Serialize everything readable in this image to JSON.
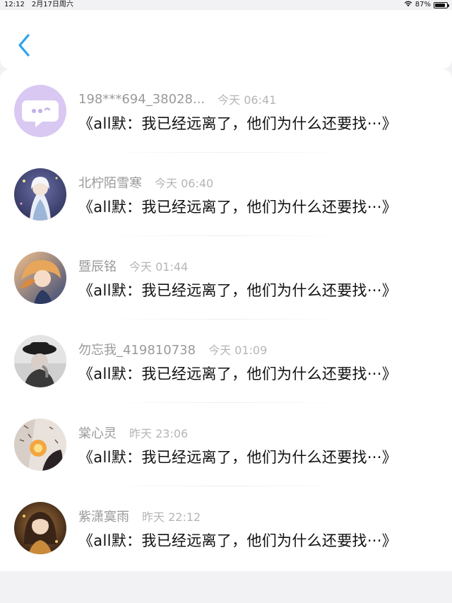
{
  "status_bar": {
    "time": "12:12",
    "date": "2月17日周六",
    "battery": "87%",
    "battery_level": 0.87
  },
  "header": {
    "back_icon": "chevron-left-icon",
    "accent_color": "#2aa3f0"
  },
  "items": [
    {
      "username": "198***694_38028...",
      "time": "今天 06:41",
      "title": "《all默：我已经远离了，他们为什么还要找···》",
      "avatar": "chat-bubble-icon"
    },
    {
      "username": "北柠陌雪寒",
      "time": "今天 06:40",
      "title": "《all默：我已经远离了，他们为什么还要找···》",
      "avatar": "anime-girl-white-hair"
    },
    {
      "username": "暨辰铭",
      "time": "今天 01:44",
      "title": "《all默：我已经远离了，他们为什么还要找···》",
      "avatar": "anime-girl-blonde"
    },
    {
      "username": "勿忘我_419810738",
      "time": "今天 01:09",
      "title": "《all默：我已经远离了，他们为什么还要找···》",
      "avatar": "photo-girl-black-hat"
    },
    {
      "username": "棠心灵",
      "time": "昨天 23:06",
      "title": "《all默：我已经远离了，他们为什么还要找···》",
      "avatar": "photo-hand-candle"
    },
    {
      "username": "紫潇寞雨",
      "time": "昨天 22:12",
      "title": "《all默：我已经远离了，他们为什么还要找···》",
      "avatar": "anime-girl-dark-hair"
    }
  ]
}
